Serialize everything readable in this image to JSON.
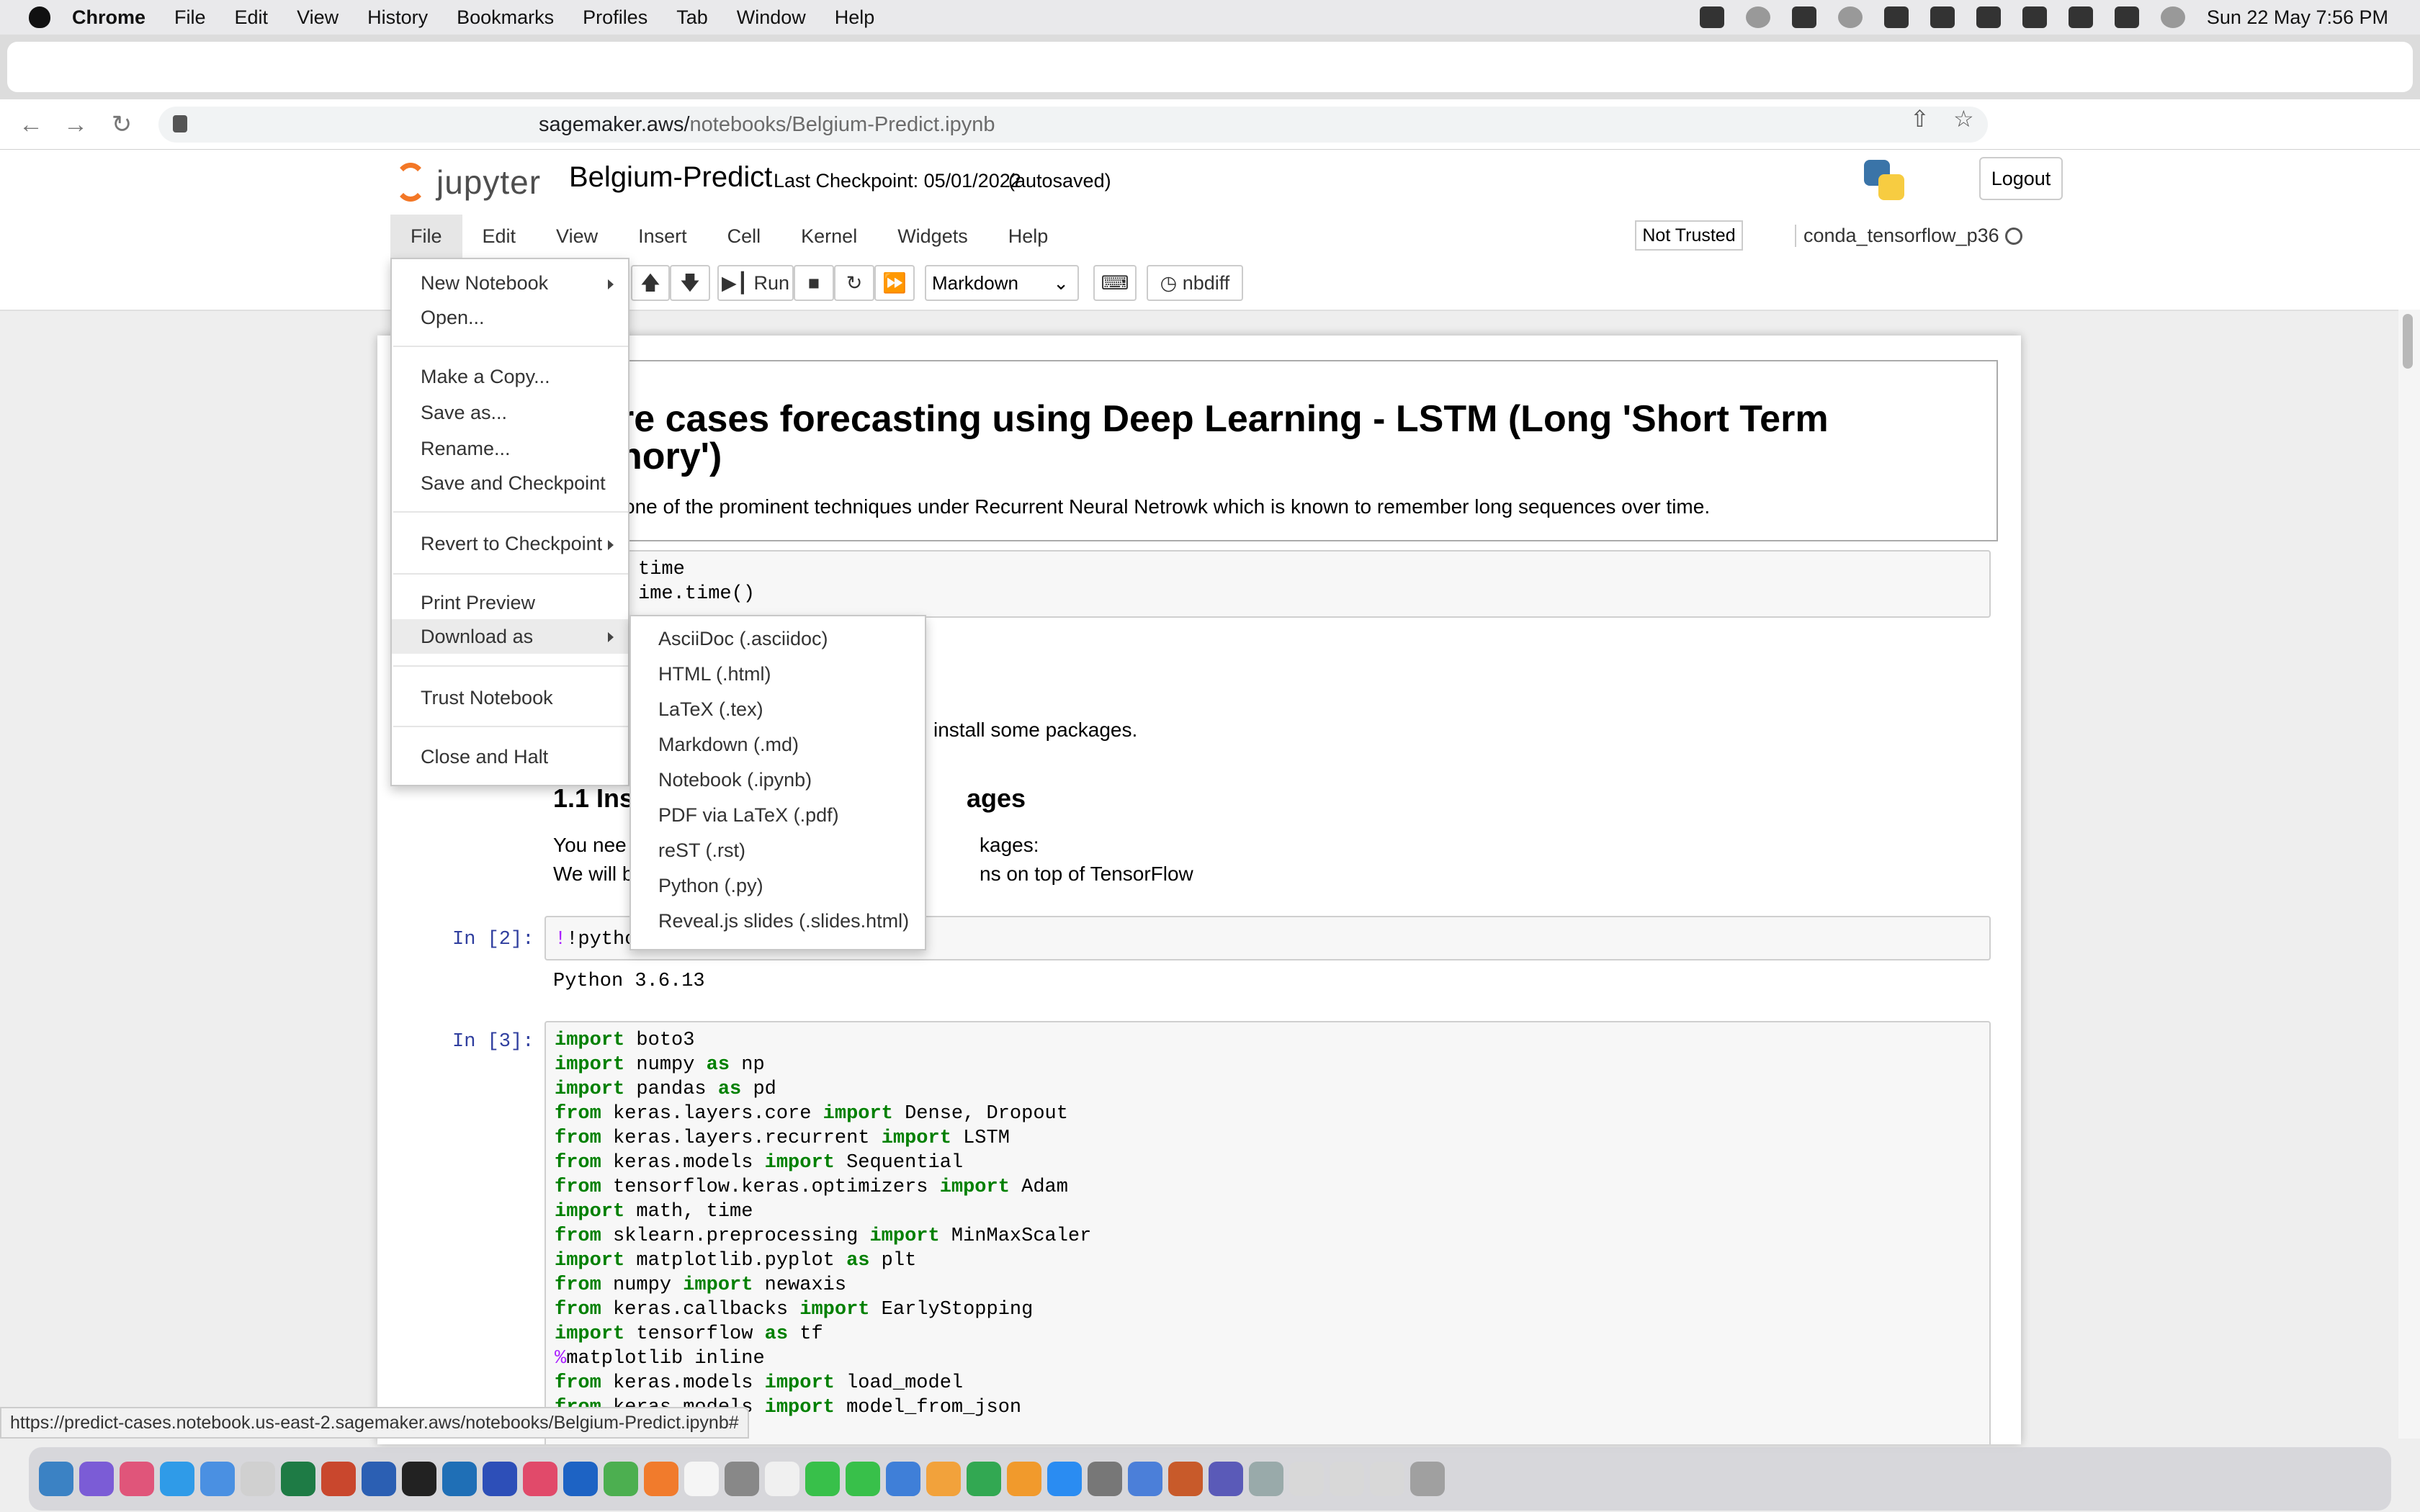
{
  "menubar": {
    "app": "Chrome",
    "items": [
      "File",
      "Edit",
      "View",
      "History",
      "Bookmarks",
      "Profiles",
      "Tab",
      "Window",
      "Help"
    ],
    "datetime": "Sun 22 May  7:56 PM"
  },
  "browser": {
    "url_host": "sagemaker.aws/",
    "url_path": "notebooks/Belgium-Predict.ipynb"
  },
  "jupyter": {
    "logo_text": "jupyter",
    "notebook_title": "Belgium-Predict",
    "checkpoint": "Last Checkpoint: 05/01/2022",
    "autosaved": "(autosaved)",
    "logout": "Logout",
    "menus": [
      "File",
      "Edit",
      "View",
      "Insert",
      "Cell",
      "Kernel",
      "Widgets",
      "Help"
    ],
    "not_trusted": "Not Trusted",
    "kernel": "conda_tensorflow_p36",
    "toolbar": {
      "run": "Run",
      "cell_type": "Markdown",
      "nbdiff": "nbdiff"
    }
  },
  "file_menu": {
    "items": [
      "New Notebook",
      "Open...",
      "Make a Copy...",
      "Save as...",
      "Rename...",
      "Save and Checkpoint",
      "Revert to Checkpoint",
      "Print Preview",
      "Download as",
      "Trust Notebook",
      "Close and Halt"
    ]
  },
  "download_submenu": {
    "items": [
      "AsciiDoc (.asciidoc)",
      "HTML (.html)",
      "LaTeX (.tex)",
      "Markdown (.md)",
      "Notebook (.ipynb)",
      "PDF via LaTeX (.pdf)",
      "reST (.rst)",
      "Python (.py)",
      "Reveal.js slides (.slides.html)"
    ]
  },
  "notebook": {
    "heading_line1": "re cases forecasting using Deep Learning - LSTM (Long 'Short Term",
    "heading_line2": "nory')",
    "intro": "one of the prominent techniques under Recurrent Neural Netrowk which is known to remember long sequences over time.",
    "cell1_line1": "time",
    "cell1_line2": "ime.time()",
    "install_text": "install some packages.",
    "section_a": "1.1 Ins",
    "section_b": "ages",
    "para1_a": "You nee",
    "para1_b": "kages:",
    "para2_a": "We will b",
    "para2_b": "ns on top of TensorFlow",
    "in2_prompt": "In [2]:",
    "in2_code": "!pytho",
    "out2": "Python 3.6.13",
    "in3_prompt": "In [3]:"
  },
  "status_url": "https://predict-cases.notebook.us-east-2.sagemaker.aws/notebooks/Belgium-Predict.ipynb#"
}
